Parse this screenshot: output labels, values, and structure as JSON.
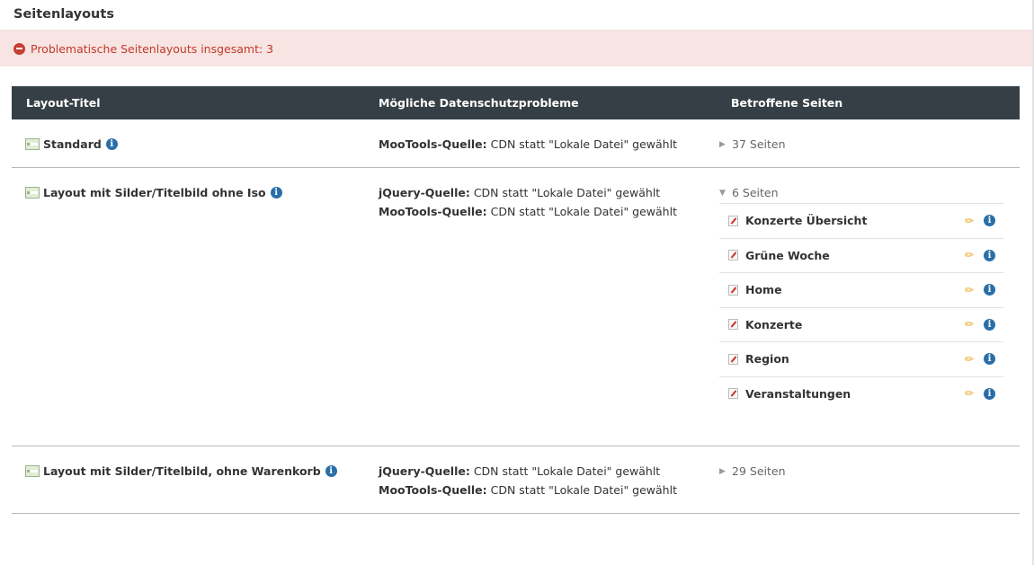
{
  "panel": {
    "title": "Seitenlayouts"
  },
  "alert": {
    "text": "Problematische Seitenlayouts insgesamt: 3"
  },
  "table": {
    "headers": [
      "Layout-Titel",
      "Mögliche Datenschutzprobleme",
      "Betroffene Seiten"
    ],
    "rows": [
      {
        "title": "Standard",
        "problems": [
          {
            "source": "MooTools-Quelle:",
            "detail": "CDN statt \"Lokale Datei\" gewählt"
          }
        ],
        "pages_label": "37 Seiten",
        "expanded": false
      },
      {
        "title": "Layout mit Silder/Titelbild ohne Iso",
        "problems": [
          {
            "source": "jQuery-Quelle:",
            "detail": "CDN statt \"Lokale Datei\" gewählt"
          },
          {
            "source": "MooTools-Quelle:",
            "detail": "CDN statt \"Lokale Datei\" gewählt"
          }
        ],
        "pages_label": "6 Seiten",
        "expanded": true,
        "pages": [
          "Konzerte Übersicht",
          "Grüne Woche",
          "Home",
          "Konzerte",
          "Region",
          "Veranstaltungen"
        ]
      },
      {
        "title": "Layout mit Silder/Titelbild, ohne Warenkorb",
        "problems": [
          {
            "source": "jQuery-Quelle:",
            "detail": "CDN statt \"Lokale Datei\" gewählt"
          },
          {
            "source": "MooTools-Quelle:",
            "detail": "CDN statt \"Lokale Datei\" gewählt"
          }
        ],
        "pages_label": "29 Seiten",
        "expanded": false
      }
    ]
  },
  "icons": {
    "alert": "minus-circle-icon",
    "layout": "layout-icon",
    "info": "info-icon",
    "page": "page-icon",
    "edit": "pencil-icon",
    "collapsed": "caret-right-icon",
    "expanded": "caret-down-icon"
  },
  "colors": {
    "header_bg": "#353f45",
    "alert_bg": "#f8e4e2",
    "alert_text": "#c0392b",
    "info": "#2a6ea8",
    "pencil": "#e8a317"
  }
}
